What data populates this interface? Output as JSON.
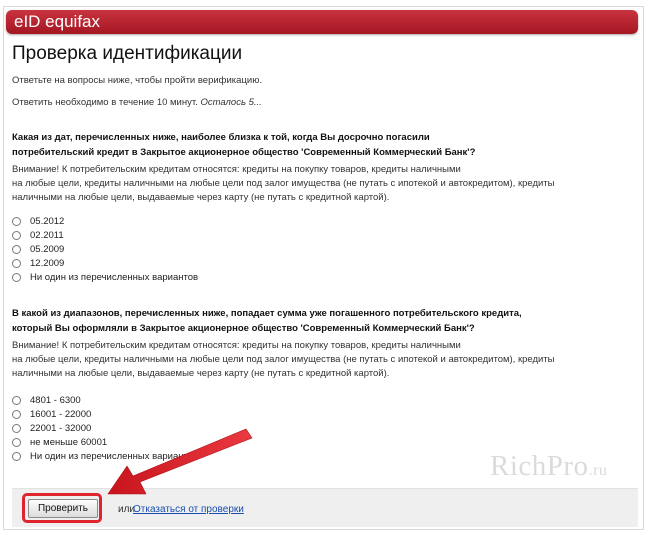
{
  "header": {
    "brand": "eID equifax"
  },
  "page": {
    "title": "Проверка идентификации",
    "intro": "Ответьте на вопросы ниже, чтобы пройти верификацию.",
    "timer_text": "Ответить необходимо в течение 10 минут.",
    "timer_remaining": "Осталось 5..."
  },
  "question1": {
    "line1": "Какая из дат, перечисленных ниже, наиболее близка к той, когда Вы досрочно погасили",
    "line2": "потребительский кредит в Закрытое акционерное общество 'Современный Коммерческий Банк'?",
    "note1": "Внимание! К потребительским кредитам относятся: кредиты на покупку товаров, кредиты наличными",
    "note2": "на любые цели, кредиты наличными на любые цели под залог имущества (не путать с ипотекой и автокредитом), кредиты",
    "note3": "наличными на любые цели, выдаваемые через карту (не путать с кредитной картой).",
    "options": [
      "05.2012",
      "02.2011",
      "05.2009",
      "12.2009",
      "Ни один из перечисленных вариантов"
    ]
  },
  "question2": {
    "line1": "В какой из диапазонов, перечисленных ниже, попадает сумма уже погашенного потребительского кредита,",
    "line2": "который Вы оформляли в Закрытое акционерное общество 'Современный Коммерческий Банк'?",
    "note1": "Внимание! К потребительским кредитам относятся: кредиты на покупку товаров, кредиты наличными",
    "note2": "на любые цели, кредиты наличными на любые цели под залог имущества (не путать с ипотекой и автокредитом), кредиты",
    "note3": "наличными на любые цели, выдаваемые через карту (не путать с кредитной картой).",
    "options": [
      "4801 - 6300",
      "16001 - 22000",
      "22001 - 32000",
      "не меньше 60001",
      "Ни один из перечисленных вариантов"
    ]
  },
  "footer": {
    "check_label": "Проверить",
    "or_label": "или",
    "cancel_label": "Отказаться от проверки"
  },
  "watermark": {
    "main": "RichPro",
    "suffix": ".ru"
  },
  "colors": {
    "header": "#b01e2a",
    "annotation": "#e0242d",
    "link": "#1a4fb0"
  }
}
